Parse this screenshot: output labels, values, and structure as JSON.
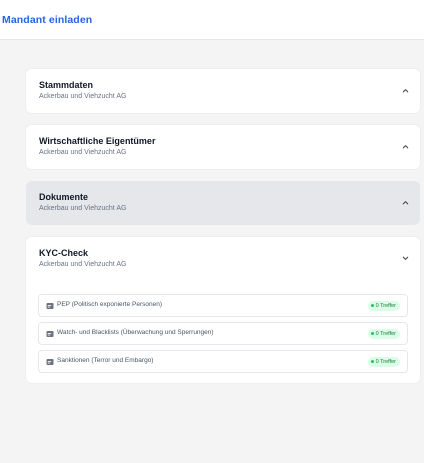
{
  "header": {
    "title": "Mandant einladen"
  },
  "sections": [
    {
      "title": "Stammdaten",
      "subtitle": "Ackerbau und Viehzucht AG"
    },
    {
      "title": "Wirtschaftliche Eigentümer",
      "subtitle": "Ackerbau und Viehzucht AG"
    },
    {
      "title": "Dokumente",
      "subtitle": "Ackerbau und Viehzucht AG"
    },
    {
      "title": "KYC-Check",
      "subtitle": "Ackerbau und Viehzucht AG"
    }
  ],
  "kyc_checks": [
    {
      "label": "PEP (Politisch exponierte Personen)",
      "badge": "0 Treffer"
    },
    {
      "label": "Watch- und Blacklists (Überwachung und Sperrungen)",
      "badge": "0 Treffer"
    },
    {
      "label": "Sanktionen (Terror und Embargo)",
      "badge": "0 Treffer"
    }
  ],
  "colors": {
    "accent": "#2563eb",
    "badge_bg": "#dcfce7",
    "badge_text": "#15803d"
  },
  "icons": {
    "collapsed": "chevron-up-icon",
    "expanded": "chevron-down-icon",
    "check": "document-icon"
  }
}
